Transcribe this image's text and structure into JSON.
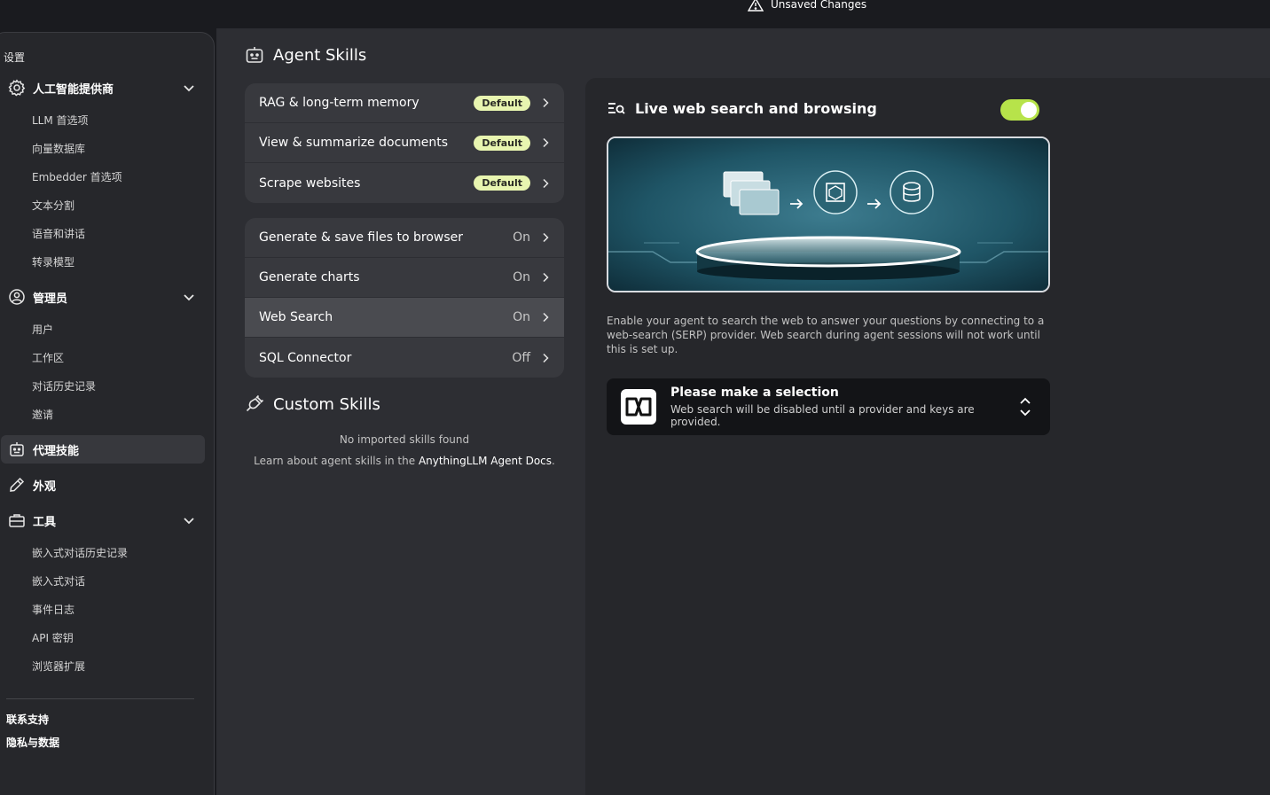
{
  "topbar": {
    "unsaved_label": "Unsaved Changes",
    "warning_icon": "warning-triangle-icon"
  },
  "sidebar": {
    "title": "设置",
    "groups": [
      {
        "label": "人工智能提供商",
        "icon": "gear-icon",
        "expanded": true,
        "items": [
          "LLM 首选项",
          "向量数据库",
          "Embedder 首选项",
          "文本分割",
          "语音和讲话",
          "转录模型"
        ]
      },
      {
        "label": "管理员",
        "icon": "user-gear-icon",
        "expanded": true,
        "items": [
          "用户",
          "工作区",
          "对话历史记录",
          "邀请"
        ]
      },
      {
        "label": "代理技能",
        "icon": "robot-icon",
        "active": true
      },
      {
        "label": "外观",
        "icon": "pen-icon"
      },
      {
        "label": "工具",
        "icon": "toolbox-icon",
        "expanded": true,
        "items": [
          "嵌入式对话历史记录",
          "嵌入式对话",
          "事件日志",
          "API 密钥",
          "浏览器扩展"
        ]
      }
    ],
    "footer": [
      "联系支持",
      "隐私与数据"
    ]
  },
  "agent_skills": {
    "title": "Agent Skills",
    "default_skills": [
      {
        "label": "RAG & long-term memory",
        "badge": "Default"
      },
      {
        "label": "View & summarize documents",
        "badge": "Default"
      },
      {
        "label": "Scrape websites",
        "badge": "Default"
      }
    ],
    "configurable_skills": [
      {
        "label": "Generate & save files to browser",
        "state": "On"
      },
      {
        "label": "Generate charts",
        "state": "On"
      },
      {
        "label": "Web Search",
        "state": "On",
        "selected": true
      },
      {
        "label": "SQL Connector",
        "state": "Off"
      }
    ]
  },
  "custom_skills": {
    "title": "Custom Skills",
    "empty_text": "No imported skills found",
    "learn_prefix": "Learn about agent skills in the ",
    "learn_link": "AnythingLLM Agent Docs",
    "learn_suffix": "."
  },
  "detail": {
    "title": "Live web search and browsing",
    "enabled": true,
    "accent_color": "#b7e34a",
    "description": "Enable your agent to search the web to answer your questions by connecting to a web-search (SERP) provider. Web search during agent sessions will not work until this is set up.",
    "provider": {
      "title": "Please make a selection",
      "subtitle": "Web search will be disabled until a provider and keys are provided."
    }
  }
}
